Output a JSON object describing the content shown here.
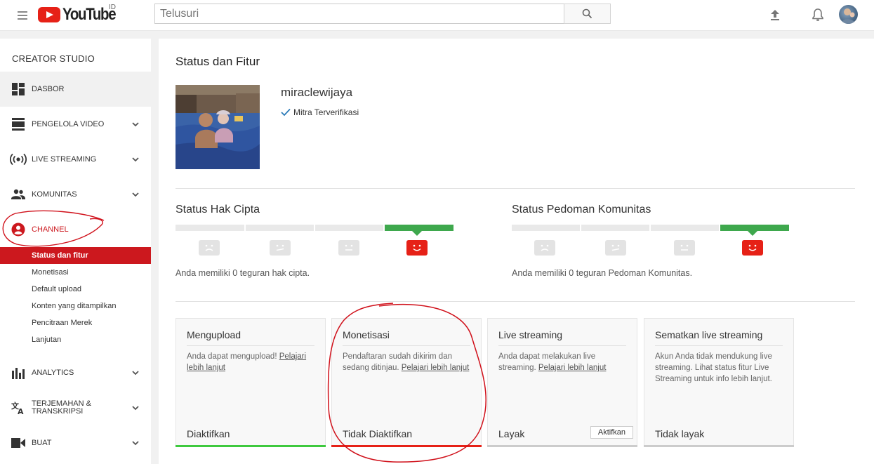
{
  "header": {
    "logo_text": "YouTube",
    "logo_country": "ID",
    "search_placeholder": "Telusuri"
  },
  "sidebar": {
    "title": "CREATOR STUDIO",
    "items": [
      {
        "label": "DASBOR",
        "icon": "dashboard-icon"
      },
      {
        "label": "PENGELOLA VIDEO",
        "icon": "video-manager-icon"
      },
      {
        "label": "LIVE STREAMING",
        "icon": "live-streaming-icon"
      },
      {
        "label": "KOMUNITAS",
        "icon": "community-icon"
      },
      {
        "label": "CHANNEL",
        "icon": "channel-icon"
      },
      {
        "label": "ANALYTICS",
        "icon": "analytics-icon"
      },
      {
        "label": "TERJEMAHAN &",
        "label2": "TRANSKRIPSI",
        "icon": "translate-icon"
      },
      {
        "label": "BUAT",
        "icon": "create-icon"
      }
    ],
    "channel_subitems": [
      "Status dan fitur",
      "Monetisasi",
      "Default upload",
      "Konten yang ditampilkan",
      "Pencitraan Merek",
      "Lanjutan"
    ]
  },
  "main": {
    "page_title": "Status dan Fitur",
    "channel_name": "miraclewijaya",
    "verified_label": "Mitra Terverifikasi",
    "copyright": {
      "title": "Status Hak Cipta",
      "text": "Anda memiliki 0 teguran hak cipta."
    },
    "community": {
      "title": "Status Pedoman Komunitas",
      "text": "Anda memiliki 0 teguran Pedoman Komunitas."
    },
    "cards": [
      {
        "title": "Mengupload",
        "desc": "Anda dapat mengupload! ",
        "link": "Pelajari lebih lanjut",
        "status": "Diaktifkan",
        "bar_color": "#3ec93e"
      },
      {
        "title": "Monetisasi",
        "desc": "Pendaftaran sudah dikirim dan sedang ditinjau. ",
        "link": "Pelajari lebih lanjut",
        "status": "Tidak Diaktifkan",
        "bar_color": "#e62117"
      },
      {
        "title": "Live streaming",
        "desc": "Anda dapat melakukan live streaming. ",
        "link": "Pelajari lebih lanjut",
        "status": "Layak",
        "button": "Aktifkan",
        "bar_color": "#cccccc"
      },
      {
        "title": "Sematkan live streaming",
        "desc": "Akun Anda tidak mendukung live streaming. Lihat status fitur Live Streaming untuk info lebih lanjut.",
        "link": "",
        "status": "Tidak layak",
        "bar_color": "#cccccc"
      }
    ]
  },
  "colors": {
    "brand_red": "#e62117",
    "active_red": "#cc181e",
    "good_green": "#3ea84d"
  }
}
